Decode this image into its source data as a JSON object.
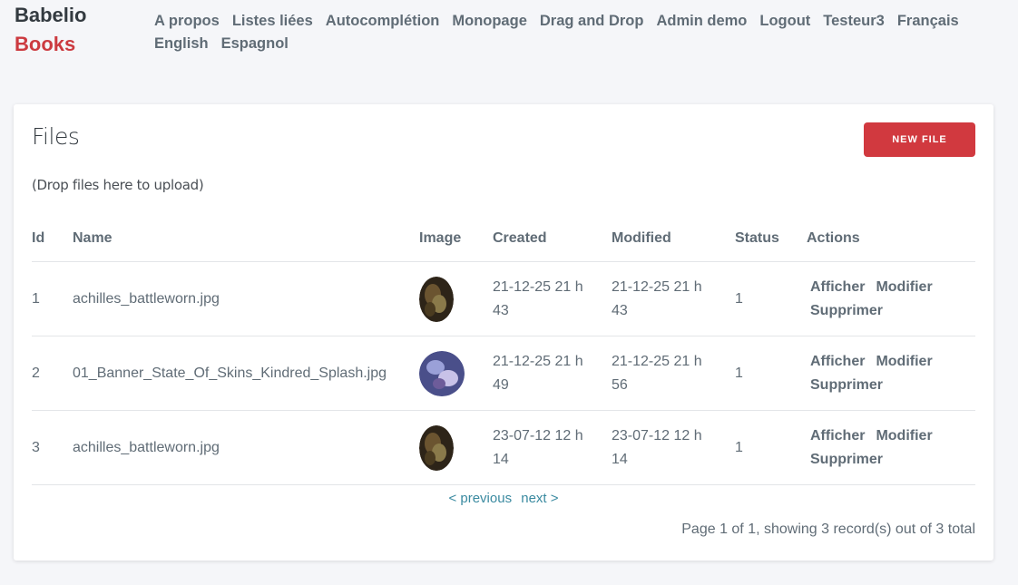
{
  "brand": {
    "line1": "Babelio",
    "line2": "Books"
  },
  "nav": [
    "A propos",
    "Listes liées",
    "Autocomplétion",
    "Monopage",
    "Drag and Drop",
    "Admin demo",
    "Logout",
    "Testeur3",
    "Français",
    "English",
    "Espagnol"
  ],
  "page": {
    "title": "Files",
    "new_button": "NEW FILE",
    "drop_hint": "(Drop files here to upload)"
  },
  "table": {
    "headers": {
      "id": "Id",
      "name": "Name",
      "image": "Image",
      "created": "Created",
      "modified": "Modified",
      "status": "Status",
      "actions": "Actions"
    },
    "rows": [
      {
        "id": "1",
        "name": "achilles_battleworn.jpg",
        "image_icon": "achilles-thumbnail",
        "created": "21-12-25 21 h 43",
        "modified": "21-12-25 21 h 43",
        "status": "1"
      },
      {
        "id": "2",
        "name": "01_Banner_State_Of_Skins_Kindred_Splash.jpg",
        "image_icon": "kindred-splash-thumbnail",
        "created": "21-12-25 21 h 49",
        "modified": "21-12-25 21 h 56",
        "status": "1"
      },
      {
        "id": "3",
        "name": "achilles_battleworn.jpg",
        "image_icon": "achilles-thumbnail",
        "created": "23-07-12 12 h 14",
        "modified": "23-07-12 12 h 14",
        "status": "1"
      }
    ],
    "actions": {
      "view": "Afficher",
      "edit": "Modifier",
      "delete": "Supprimer"
    }
  },
  "pager": {
    "previous": "< previous",
    "next": "next >"
  },
  "summary": "Page 1 of 1, showing 3 record(s) out of 3 total",
  "colors": {
    "brand_red": "#cc3a40",
    "button": "#d1393f",
    "pager_link": "#3a8aa0"
  }
}
